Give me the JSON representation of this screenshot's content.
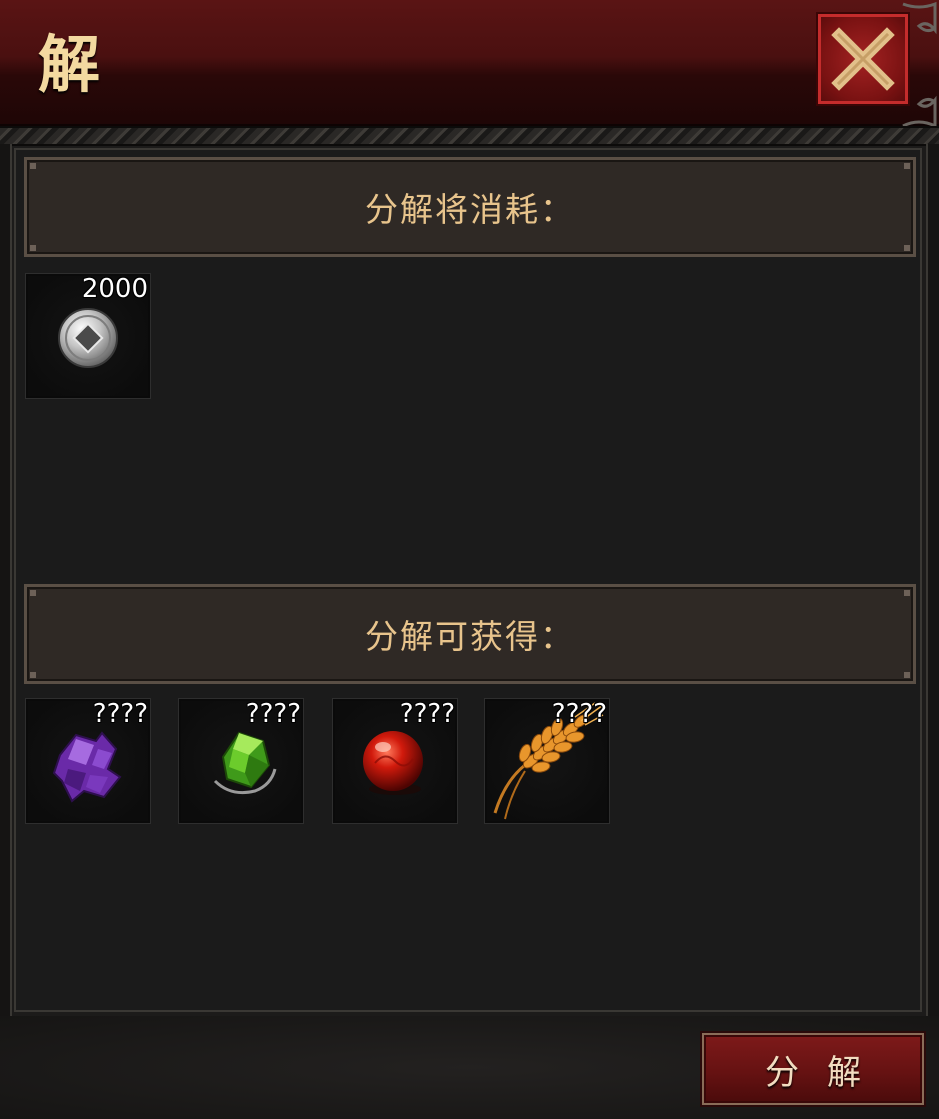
{
  "header": {
    "title": "解"
  },
  "close_button": {
    "icon": "close-icon",
    "color": "#a32222"
  },
  "consume_section": {
    "label": "分解将消耗：",
    "items": [
      {
        "icon": "silver-coin-icon",
        "count": "2000"
      }
    ]
  },
  "gain_section": {
    "label": "分解可获得：",
    "items": [
      {
        "icon": "purple-crystal-icon",
        "count": "????"
      },
      {
        "icon": "green-gem-icon",
        "count": "????"
      },
      {
        "icon": "red-orb-icon",
        "count": "????"
      },
      {
        "icon": "wheat-icon",
        "count": "????"
      }
    ]
  },
  "action_button": {
    "label": "分解"
  }
}
